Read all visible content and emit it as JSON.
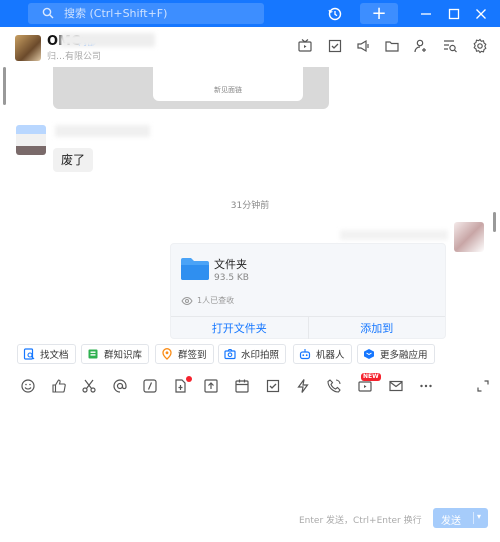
{
  "titlebar": {
    "search_placeholder": "搜索 (Ctrl+Shift+F)",
    "plus_label": "+",
    "accent": "#1677ff"
  },
  "header": {
    "group_name": "OMC",
    "tag": "内部",
    "subtitle": "归…有限公司"
  },
  "chat": {
    "prev_card_caption": "新见面链",
    "message_text": "废了",
    "timestamp": "31分钟前",
    "file": {
      "name": "文件夹",
      "size": "93.5 KB",
      "viewed": "1人已查收",
      "open_label": "打开文件夹",
      "add_label": "添加到"
    }
  },
  "quick_apps": [
    {
      "label": "找文档",
      "icon": "find-doc-icon",
      "color": "#1677ff"
    },
    {
      "label": "群知识库",
      "icon": "knowledge-icon",
      "color": "#2fb150"
    },
    {
      "label": "群签到",
      "icon": "checkin-icon",
      "color": "#fa8c16"
    },
    {
      "label": "水印拍照",
      "icon": "camera-icon",
      "color": "#1677ff"
    },
    {
      "label": "机器人",
      "icon": "robot-icon",
      "color": "#1677ff"
    },
    {
      "label": "更多融应用",
      "icon": "more-apps-icon",
      "color": "#1677ff"
    }
  ],
  "toolbar": {
    "new_badge": "NEW"
  },
  "input": {
    "hint": "Enter 发送，Ctrl+Enter 换行",
    "send_label": "发送",
    "send_arrow": "▾"
  }
}
